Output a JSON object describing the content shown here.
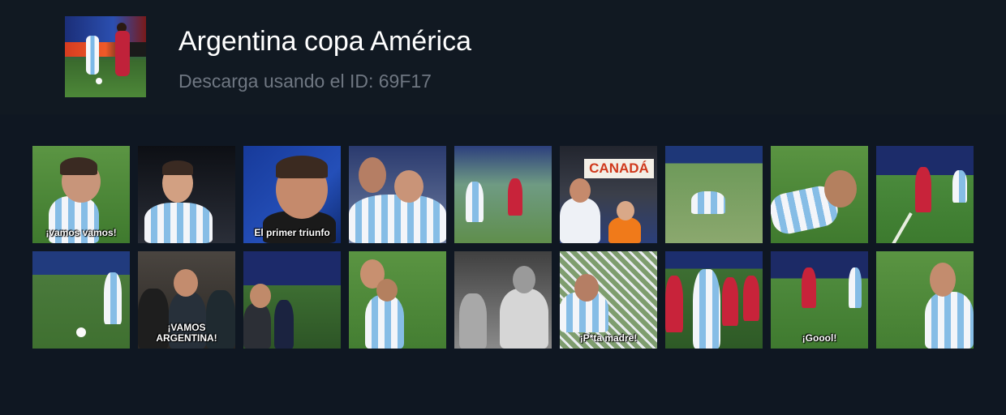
{
  "header": {
    "title": "Argentina copa América",
    "subtitle": "Descarga usando el ID: 69F17",
    "cover_icon": "soccer-cover-image"
  },
  "tiles": [
    {
      "caption": "¡vamos vamos!",
      "bg": "#4f8a38"
    },
    {
      "caption": "",
      "bg": "#1a1d24"
    },
    {
      "caption": "El primer triunfo",
      "bg": "#1d3b8c"
    },
    {
      "caption": "",
      "bg": "#3a4b7a"
    },
    {
      "caption": "",
      "bg": "#5d8a6e"
    },
    {
      "caption": "CANADÁ",
      "bg": "#2b2f3a"
    },
    {
      "caption": "",
      "bg": "#6e8f5a"
    },
    {
      "caption": "",
      "bg": "#4c7d36"
    },
    {
      "caption": "",
      "bg": "#3f7a2f"
    },
    {
      "caption": "",
      "bg": "#4a7a3c"
    },
    {
      "caption": "¡VAMOS ARGENTINA!",
      "bg": "#3a3430"
    },
    {
      "caption": "",
      "bg": "#2d3240"
    },
    {
      "caption": "",
      "bg": "#4e8736"
    },
    {
      "caption": "",
      "bg": "#6b6b6b"
    },
    {
      "caption": "¡P*ta madre!",
      "bg": "#5d7d4e"
    },
    {
      "caption": "",
      "bg": "#3b6a30"
    },
    {
      "caption": "¡Goool!",
      "bg": "#4d8a3a"
    },
    {
      "caption": "",
      "bg": "#4b8a3b"
    }
  ]
}
